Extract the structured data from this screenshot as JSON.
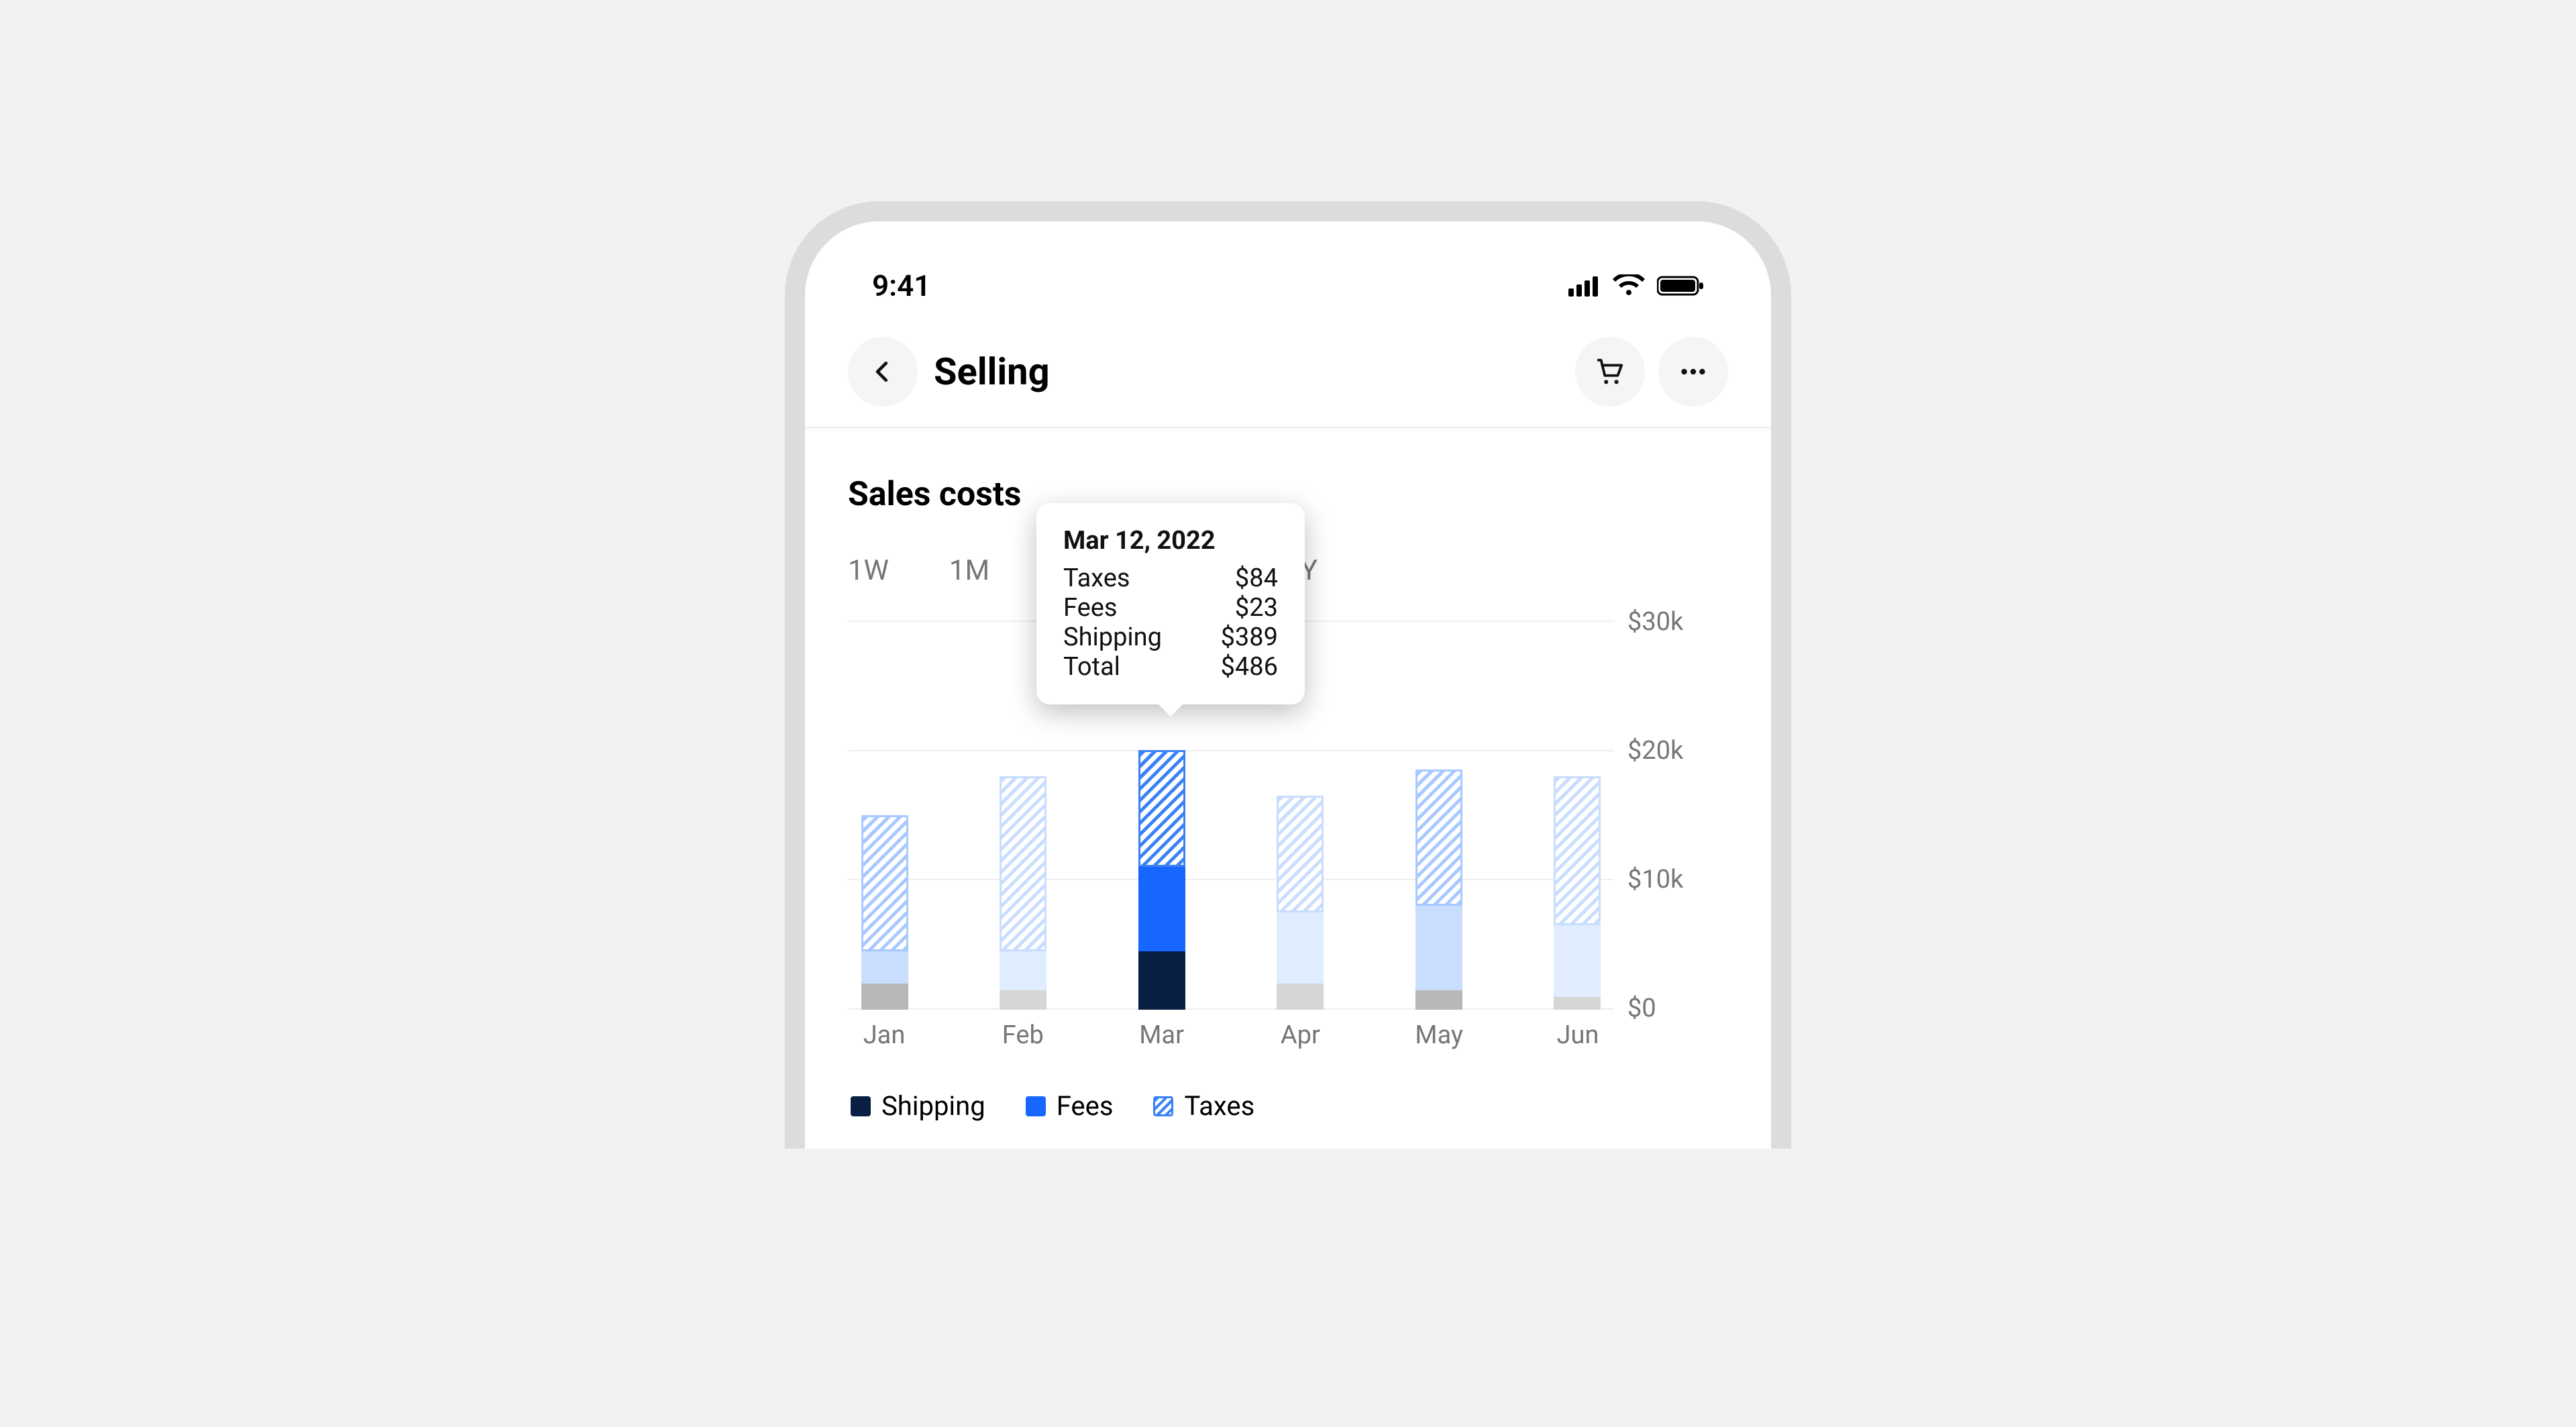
{
  "status": {
    "time": "9:41"
  },
  "nav": {
    "title": "Selling"
  },
  "section": {
    "title": "Sales costs"
  },
  "range_tabs": [
    "1W",
    "1M",
    "1Y"
  ],
  "y_ticks": [
    "$30k",
    "$20k",
    "$10k",
    "$0"
  ],
  "x_categories": [
    "Jan",
    "Feb",
    "Mar",
    "Apr",
    "May",
    "Jun"
  ],
  "legend": {
    "shipping": "Shipping",
    "fees": "Fees",
    "taxes": "Taxes"
  },
  "tooltip": {
    "title": "Mar 12, 2022",
    "rows": [
      {
        "label": "Taxes",
        "value": "$84"
      },
      {
        "label": "Fees",
        "value": "$23"
      },
      {
        "label": "Shipping",
        "value": "$389"
      },
      {
        "label": "Total",
        "value": "$486"
      }
    ]
  },
  "chart_data": {
    "type": "bar",
    "stacked": true,
    "title": "Sales costs",
    "xlabel": "",
    "ylabel": "",
    "ylim": [
      0,
      30000
    ],
    "categories": [
      "Jan",
      "Feb",
      "Mar",
      "Apr",
      "May",
      "Jun"
    ],
    "series": [
      {
        "name": "Shipping",
        "values": [
          2000,
          1500,
          4500,
          2000,
          1500,
          1000
        ]
      },
      {
        "name": "Fees",
        "values": [
          2500,
          3000,
          6500,
          5500,
          6500,
          5500
        ]
      },
      {
        "name": "Taxes",
        "values": [
          10500,
          13500,
          9000,
          9000,
          10500,
          11500
        ]
      }
    ],
    "y_ticks": [
      0,
      10000,
      20000,
      30000
    ],
    "y_tick_labels": [
      "$0",
      "$10k",
      "$20k",
      "$30k"
    ],
    "highlighted_index": 2,
    "tooltip": {
      "date": "Mar 12, 2022",
      "Taxes": 84,
      "Fees": 23,
      "Shipping": 389,
      "Total": 486
    },
    "legend": [
      "Shipping",
      "Fees",
      "Taxes"
    ]
  }
}
